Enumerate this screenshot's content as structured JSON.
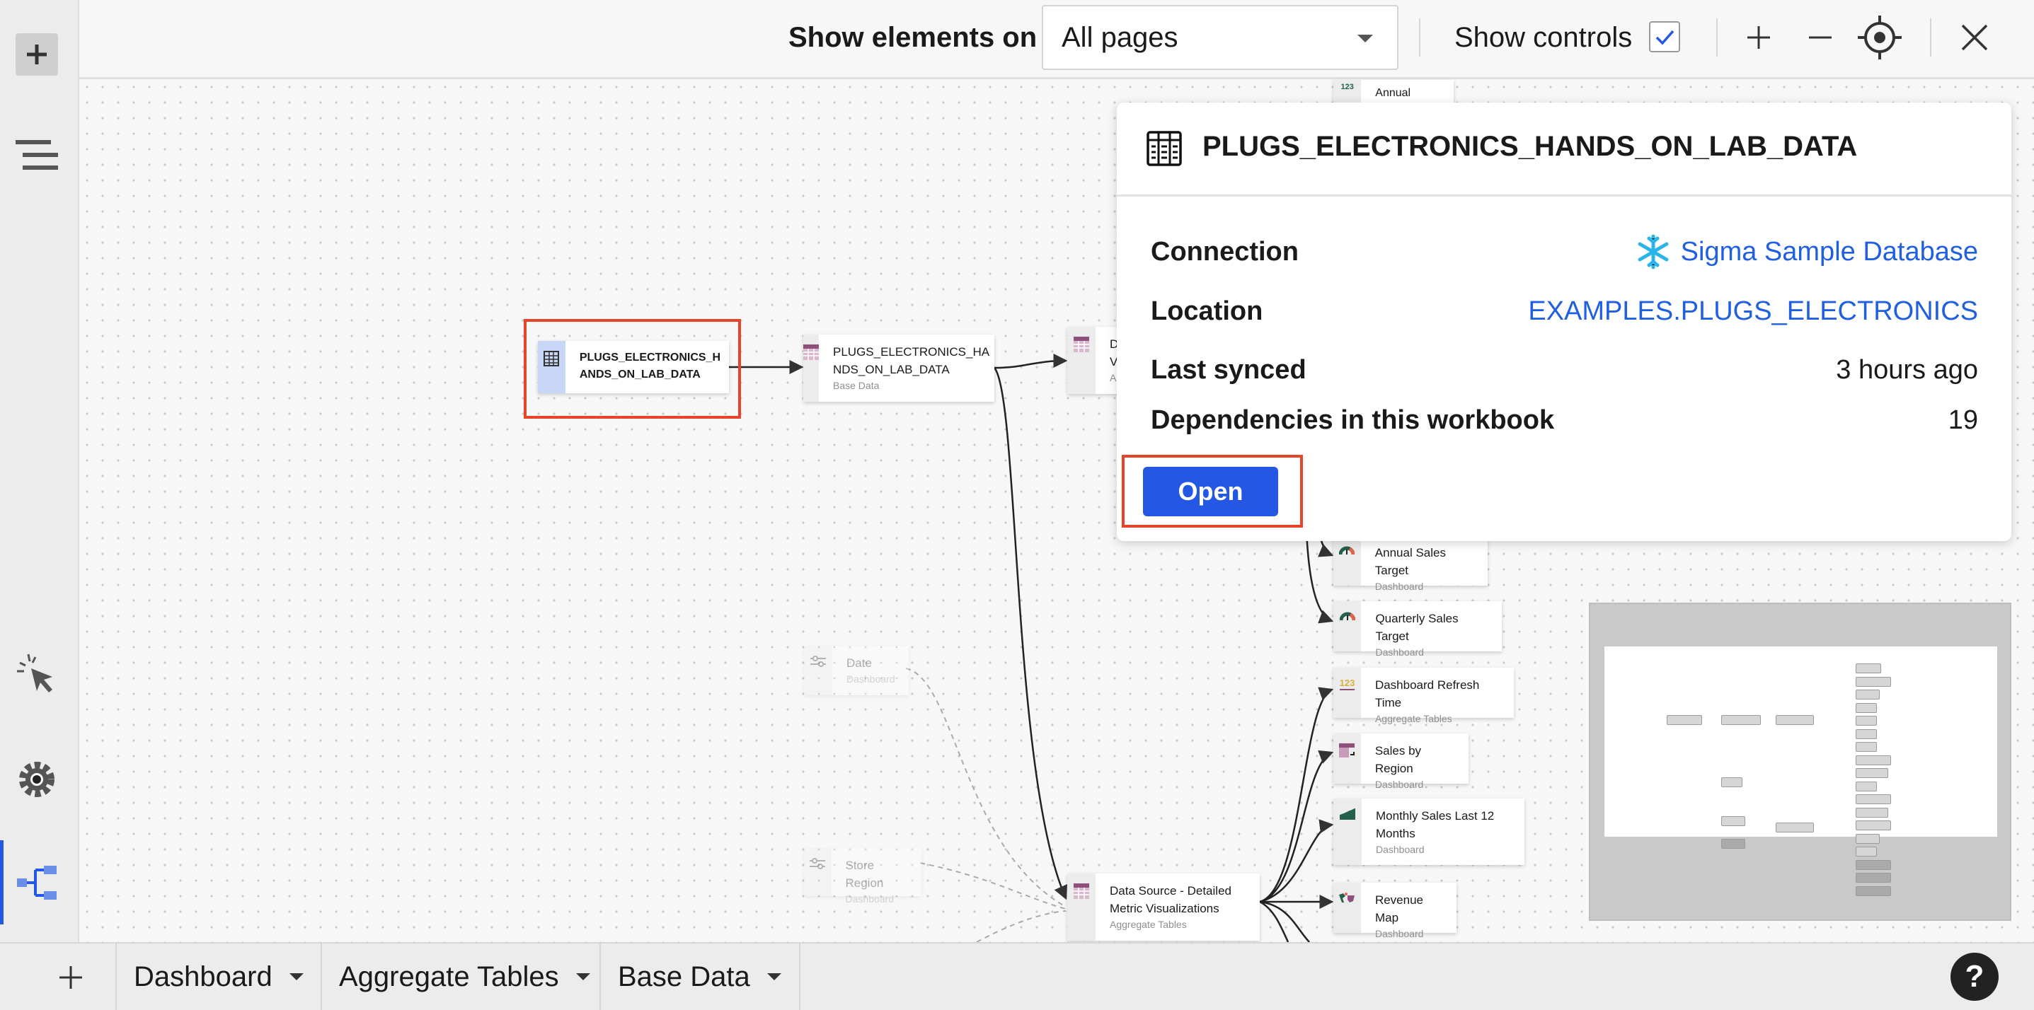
{
  "topbar": {
    "show_elements_label": "Show elements on",
    "show_elements_value": "All pages",
    "show_controls_label": "Show controls",
    "show_controls_checked": true
  },
  "nodes": [
    {
      "title": "PLUGS_ELECTRONICS_HANDS_ON_LAB_DATA",
      "line1": "PLUGS_ELECTRONICS_H",
      "line2": "ANDS_ON_LAB_DATA",
      "subtitle": "",
      "selected": true
    },
    {
      "line1": "PLUGS_ELECTRONICS_HA",
      "line2": "NDS_ON_LAB_DATA",
      "subtitle": "Base Data"
    },
    {
      "line1": "D",
      "line2": "V",
      "subtitle": "A"
    },
    {
      "title": "Annual Stores"
    },
    {
      "title": "Annual Sales Target",
      "subtitle": "Dashboard"
    },
    {
      "title": "Quarterly Sales Target",
      "subtitle": "Dashboard"
    },
    {
      "title": "Dashboard Refresh Time",
      "subtitle": "Aggregate Tables"
    },
    {
      "title": "Sales by Region",
      "subtitle": "Dashboard"
    },
    {
      "line1": "Monthly Sales Last 12",
      "line2": "Months",
      "subtitle": "Dashboard"
    },
    {
      "title": "Revenue Map",
      "subtitle": "Dashboard"
    },
    {
      "title": "Date",
      "subtitle": "Dashboard"
    },
    {
      "title": "Store Region",
      "subtitle": "Dashboard"
    },
    {
      "line1": "Data Source - Detailed",
      "line2": "Metric Visualizations",
      "subtitle": "Aggregate Tables"
    }
  ],
  "popover": {
    "title": "PLUGS_ELECTRONICS_HANDS_ON_LAB_DATA",
    "connection_label": "Connection",
    "connection_value": "Sigma Sample Database",
    "location_label": "Location",
    "location_value": "EXAMPLES.PLUGS_ELECTRONICS",
    "last_synced_label": "Last synced",
    "last_synced_value": "3 hours ago",
    "dependencies_label": "Dependencies in this workbook",
    "dependencies_value": "19",
    "open_label": "Open"
  },
  "bottom": {
    "tabs": [
      {
        "label": "Dashboard"
      },
      {
        "label": "Aggregate Tables"
      },
      {
        "label": "Base Data"
      }
    ],
    "help": "?"
  },
  "colors": {
    "accent": "#2457e3",
    "highlight": "#e8442a",
    "table_icon": "#8e4f7a",
    "dashboard_green": "#245f4a"
  }
}
